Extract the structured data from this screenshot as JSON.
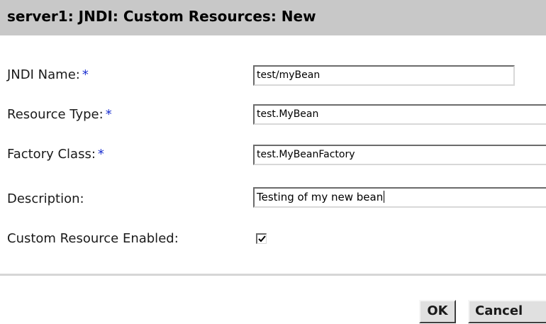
{
  "page": {
    "title": "server1: JNDI: Custom Resources: New"
  },
  "form": {
    "required_marker": "*",
    "jndi_name": {
      "label": "JNDI Name:",
      "value": "test/myBean"
    },
    "resource_type": {
      "label": "Resource Type:",
      "value": "test.MyBean"
    },
    "factory_class": {
      "label": "Factory Class:",
      "value": "test.MyBeanFactory"
    },
    "description": {
      "label": "Description:",
      "value": "Testing of my new bean"
    },
    "enabled": {
      "label": "Custom Resource Enabled:",
      "checked": true
    }
  },
  "buttons": {
    "ok_label": "OK",
    "cancel_label": "Cancel"
  },
  "colors": {
    "title_bar": "#c8c8c8",
    "required_marker": "#1a2fd0",
    "button_face": "#e0e0e0"
  }
}
